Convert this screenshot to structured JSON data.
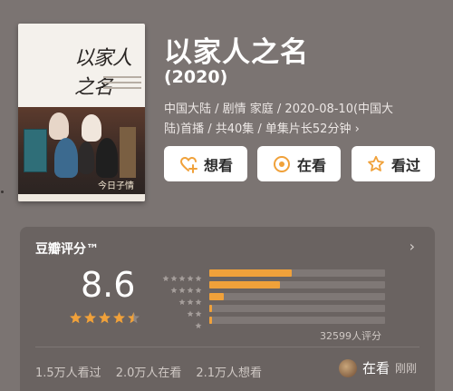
{
  "poster": {
    "title_art": "以家人之名",
    "corner_text": "今日子情"
  },
  "movie": {
    "title": "以家人之名",
    "year": "(2020)",
    "info": "中国大陆 / 剧情 家庭 / 2020-08-10(中国大陆)首播 / 共40集 / 单集片长52分钟",
    "info_chevron": "›"
  },
  "actions": [
    {
      "label": "想看",
      "icon": "heart-plus-icon"
    },
    {
      "label": "在看",
      "icon": "target-icon"
    },
    {
      "label": "看过",
      "icon": "star-outline-icon"
    }
  ],
  "rating": {
    "header": "豆瓣评分™",
    "chevron": "›",
    "score": "8.6",
    "stars_value": 4.5,
    "stars_max": 5,
    "distribution": [
      {
        "stars": 5,
        "fraction": 0.47
      },
      {
        "stars": 4,
        "fraction": 0.4
      },
      {
        "stars": 3,
        "fraction": 0.08
      },
      {
        "stars": 2,
        "fraction": 0.015
      },
      {
        "stars": 1,
        "fraction": 0.015
      }
    ],
    "count": "32599人评分"
  },
  "stats": {
    "watched": "1.5万人看过",
    "watching": "2.0万人在看",
    "want": "2.1万人想看"
  },
  "status": {
    "label": "在看",
    "time": "刚刚"
  },
  "colors": {
    "background": "#7b7472",
    "accent": "#f0a13a",
    "card": "#6a6361"
  }
}
